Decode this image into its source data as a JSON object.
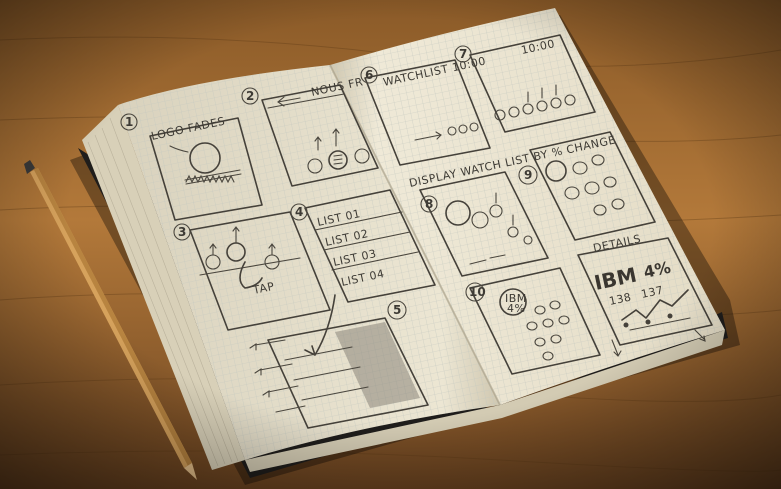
{
  "scene": {
    "subject": "sketchbook",
    "colors": {
      "table": "#b07a3a",
      "table_dark": "#5a3a18",
      "paper": "#ece6d3",
      "grid": "#c9cfc8",
      "pencil_graphite": "#45413a",
      "pencil_wood": "#d6a25c",
      "cover": "#1f1d1b"
    }
  },
  "left_page": {
    "frame1": {
      "number": "1",
      "label": "LOGO FADES"
    },
    "frame2": {
      "number": "2",
      "header": "NOUS FR"
    },
    "frame3": {
      "number": "3",
      "label": "TAP"
    },
    "frame4": {
      "number": "4",
      "list_items": [
        "LIST 01",
        "LIST 02",
        "LIST 03",
        "LIST 04"
      ]
    },
    "frame5": {
      "number": "5"
    }
  },
  "right_page": {
    "frame6": {
      "number": "6",
      "header": "WATCHLIST 10:00"
    },
    "frame7": {
      "number": "7",
      "header": "10:00"
    },
    "caption_between": "DISPLAY WATCH LIST BY % CHANGE",
    "frame8": {
      "number": "8"
    },
    "frame9": {
      "number": "9"
    },
    "frame10": {
      "number": "10",
      "badge": "IBM",
      "badge_pct": "4%"
    },
    "details": {
      "label": "DETAILS",
      "ticker": "IBM",
      "change": "4%",
      "val1": "138",
      "val2": "137"
    }
  }
}
